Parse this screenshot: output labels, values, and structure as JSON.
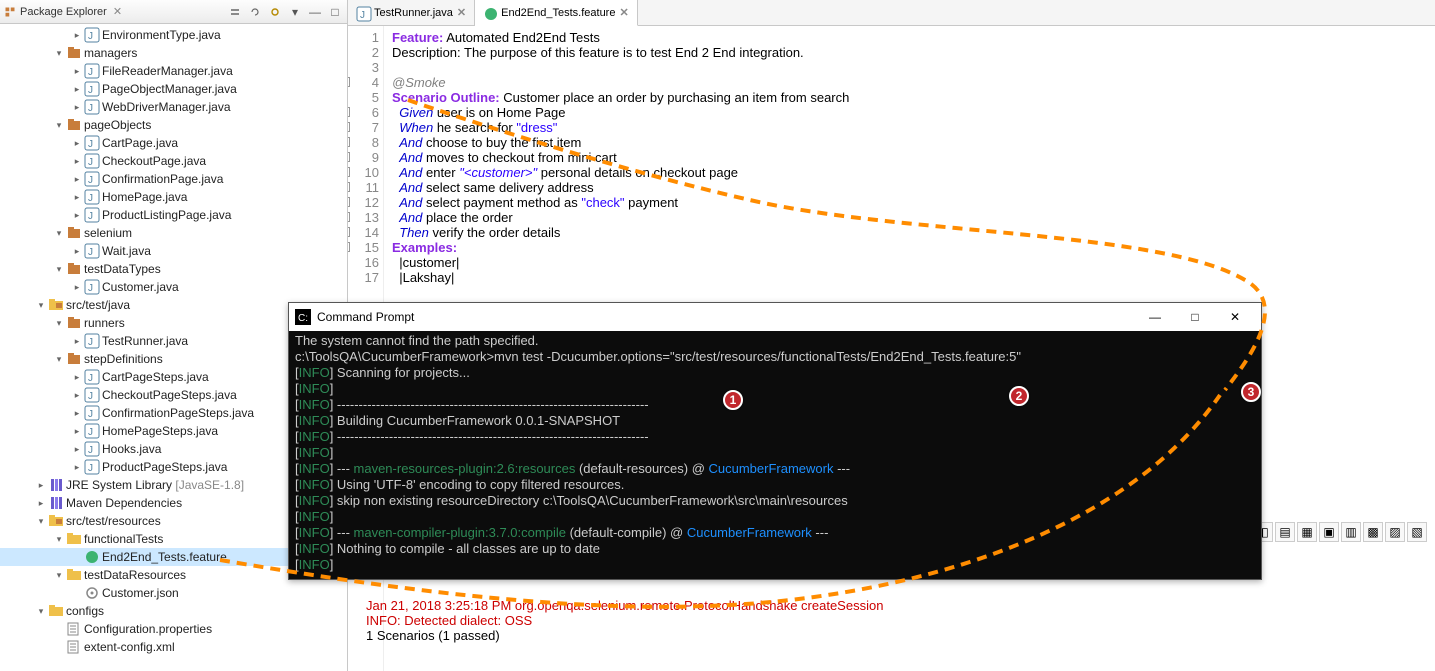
{
  "header": {
    "title": "Package Explorer"
  },
  "tree": [
    {
      "d": 3,
      "ico": "java",
      "arrow": "r",
      "label": "EnvironmentType.java"
    },
    {
      "d": 2,
      "ico": "pkg",
      "arrow": "d",
      "label": "managers"
    },
    {
      "d": 3,
      "ico": "java",
      "arrow": "r",
      "label": "FileReaderManager.java"
    },
    {
      "d": 3,
      "ico": "java",
      "arrow": "r",
      "label": "PageObjectManager.java"
    },
    {
      "d": 3,
      "ico": "java",
      "arrow": "r",
      "label": "WebDriverManager.java"
    },
    {
      "d": 2,
      "ico": "pkg",
      "arrow": "d",
      "label": "pageObjects"
    },
    {
      "d": 3,
      "ico": "java",
      "arrow": "r",
      "label": "CartPage.java"
    },
    {
      "d": 3,
      "ico": "java",
      "arrow": "r",
      "label": "CheckoutPage.java"
    },
    {
      "d": 3,
      "ico": "java",
      "arrow": "r",
      "label": "ConfirmationPage.java"
    },
    {
      "d": 3,
      "ico": "java",
      "arrow": "r",
      "label": "HomePage.java"
    },
    {
      "d": 3,
      "ico": "java",
      "arrow": "r",
      "label": "ProductListingPage.java"
    },
    {
      "d": 2,
      "ico": "pkg",
      "arrow": "d",
      "label": "selenium"
    },
    {
      "d": 3,
      "ico": "java",
      "arrow": "r",
      "label": "Wait.java"
    },
    {
      "d": 2,
      "ico": "pkg",
      "arrow": "d",
      "label": "testDataTypes"
    },
    {
      "d": 3,
      "ico": "java",
      "arrow": "r",
      "label": "Customer.java"
    },
    {
      "d": 1,
      "ico": "srcfld",
      "arrow": "d",
      "label": "src/test/java"
    },
    {
      "d": 2,
      "ico": "pkg",
      "arrow": "d",
      "label": "runners"
    },
    {
      "d": 3,
      "ico": "java",
      "arrow": "r",
      "label": "TestRunner.java"
    },
    {
      "d": 2,
      "ico": "pkg",
      "arrow": "d",
      "label": "stepDefinitions"
    },
    {
      "d": 3,
      "ico": "java",
      "arrow": "r",
      "label": "CartPageSteps.java"
    },
    {
      "d": 3,
      "ico": "java",
      "arrow": "r",
      "label": "CheckoutPageSteps.java"
    },
    {
      "d": 3,
      "ico": "java",
      "arrow": "r",
      "label": "ConfirmationPageSteps.java"
    },
    {
      "d": 3,
      "ico": "java",
      "arrow": "r",
      "label": "HomePageSteps.java"
    },
    {
      "d": 3,
      "ico": "java",
      "arrow": "r",
      "label": "Hooks.java"
    },
    {
      "d": 3,
      "ico": "java",
      "arrow": "r",
      "label": "ProductPageSteps.java"
    },
    {
      "d": 1,
      "ico": "lib",
      "arrow": "r",
      "label": "JRE System Library",
      "suffix": " [JavaSE-1.8]"
    },
    {
      "d": 1,
      "ico": "lib",
      "arrow": "r",
      "label": "Maven Dependencies"
    },
    {
      "d": 1,
      "ico": "srcfld",
      "arrow": "d",
      "label": "src/test/resources"
    },
    {
      "d": 2,
      "ico": "fld",
      "arrow": "d",
      "label": "functionalTests"
    },
    {
      "d": 3,
      "ico": "feat",
      "arrow": "",
      "label": "End2End_Tests.feature",
      "selected": true
    },
    {
      "d": 2,
      "ico": "fld",
      "arrow": "d",
      "label": "testDataResources"
    },
    {
      "d": 3,
      "ico": "json",
      "arrow": "",
      "label": "Customer.json"
    },
    {
      "d": 1,
      "ico": "fld",
      "arrow": "d",
      "label": "configs"
    },
    {
      "d": 2,
      "ico": "cfg",
      "arrow": "",
      "label": "Configuration.properties"
    },
    {
      "d": 2,
      "ico": "cfg",
      "arrow": "",
      "label": "extent-config.xml"
    }
  ],
  "tabs": [
    {
      "label": "TestRunner.java",
      "ico": "java",
      "active": false
    },
    {
      "label": "End2End_Tests.feature",
      "ico": "feat",
      "active": true
    }
  ],
  "code": [
    {
      "n": 1,
      "html": "<span class='kw-feature'>Feature:</span> Automated End2End Tests"
    },
    {
      "n": 2,
      "html": "Description: The purpose of this feature is to test End 2 End integration."
    },
    {
      "n": 3,
      "html": ""
    },
    {
      "n": 4,
      "fold": true,
      "html": "<span class='kw-tag'>@Smoke</span>"
    },
    {
      "n": 5,
      "html": "<span class='kw-scenario'>Scenario Outline:</span> Customer place an order by purchasing an item from search"
    },
    {
      "n": 6,
      "fold": true,
      "html": "  <span class='kw-step'>Given</span> user is on Home Page"
    },
    {
      "n": 7,
      "fold": true,
      "html": "  <span class='kw-step'>When</span> he search for <span class='str'>\"dress\"</span>"
    },
    {
      "n": 8,
      "fold": true,
      "html": "  <span class='kw-step'>And</span> choose to buy the first item"
    },
    {
      "n": 9,
      "fold": true,
      "html": "  <span class='kw-step'>And</span> moves to checkout from mini cart"
    },
    {
      "n": 10,
      "fold": true,
      "html": "  <span class='kw-step'>And</span> enter <span class='placeholder'>\"&lt;customer&gt;\"</span> personal details on checkout page"
    },
    {
      "n": 11,
      "fold": true,
      "html": "  <span class='kw-step'>And</span> select same delivery address"
    },
    {
      "n": 12,
      "fold": true,
      "html": "  <span class='kw-step'>And</span> select payment method as <span class='str'>\"check\"</span> payment"
    },
    {
      "n": 13,
      "fold": true,
      "html": "  <span class='kw-step'>And</span> place the order"
    },
    {
      "n": 14,
      "fold": true,
      "html": "  <span class='kw-step'>Then</span> verify the order details"
    },
    {
      "n": 15,
      "fold": true,
      "html": "<span class='kw-examples'>Examples:</span>"
    },
    {
      "n": 16,
      "html": "  |customer|"
    },
    {
      "n": 17,
      "html": "  |Lakshay|"
    }
  ],
  "cmd": {
    "title": "Command Prompt",
    "lines": [
      {
        "html": "The system cannot find the path specified."
      },
      {
        "html": ""
      },
      {
        "html": "c:\\ToolsQA\\CucumberFramework>mvn test -Dcucumber.options=\"src/test/resources/functionalTests/End2End_Tests.feature:5\""
      },
      {
        "html": "[<span class='info-tag'>INFO</span>] Scanning for projects..."
      },
      {
        "html": "[<span class='info-tag'>INFO</span>]"
      },
      {
        "html": "[<span class='info-tag'>INFO</span>] ------------------------------------------------------------------------"
      },
      {
        "html": "[<span class='info-tag'>INFO</span>] Building CucumberFramework 0.0.1-SNAPSHOT"
      },
      {
        "html": "[<span class='info-tag'>INFO</span>] ------------------------------------------------------------------------"
      },
      {
        "html": "[<span class='info-tag'>INFO</span>]"
      },
      {
        "html": "[<span class='info-tag'>INFO</span>] --- <span class='mvn-plugin'>maven-resources-plugin:2.6:resources</span> <span class='cmd-white'>(default-resources)</span> @ <span class='mvn-proj'>CucumberFramework</span> ---"
      },
      {
        "html": "[<span class='info-tag'>INFO</span>] Using 'UTF-8' encoding to copy filtered resources."
      },
      {
        "html": "[<span class='info-tag'>INFO</span>] skip non existing resourceDirectory c:\\ToolsQA\\CucumberFramework\\src\\main\\resources"
      },
      {
        "html": "[<span class='info-tag'>INFO</span>]"
      },
      {
        "html": "[<span class='info-tag'>INFO</span>] --- <span class='mvn-plugin'>maven-compiler-plugin:3.7.0:compile</span> <span class='cmd-white'>(default-compile)</span> @ <span class='mvn-proj'>CucumberFramework</span> ---"
      },
      {
        "html": "[<span class='info-tag'>INFO</span>] Nothing to compile - all classes are up to date"
      },
      {
        "html": "[<span class='info-tag'>INFO</span>]"
      }
    ]
  },
  "console": {
    "line1": "Jan 21, 2018 3:25:18 PM org.openqa.selenium.remote.ProtocolHandshake createSession",
    "line2": "INFO: Detected dialect: OSS",
    "line3": "",
    "line4": "1 Scenarios (1 passed)"
  },
  "badges": {
    "b1": "1",
    "b2": "2",
    "b3": "3"
  },
  "colors": {
    "accent": "#cce8ff",
    "anno": "#ff8c00",
    "badge": "#c1272d"
  }
}
